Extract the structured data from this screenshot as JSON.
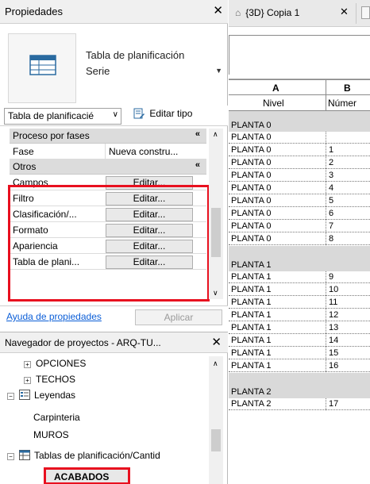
{
  "properties": {
    "title": "Propiedades",
    "type_name_line1": "Tabla de planificación",
    "type_name_line2": "Serie",
    "selector_value": "Tabla de planificacié",
    "edit_type_label": "Editar tipo",
    "groups": [
      {
        "label": "Proceso por fases",
        "rows": [
          {
            "name": "Fase",
            "value": "Nueva constru..."
          }
        ]
      },
      {
        "label": "Otros",
        "rows": [
          {
            "name": "Campos",
            "button": "Editar..."
          },
          {
            "name": "Filtro",
            "button": "Editar..."
          },
          {
            "name": "Clasificación/...",
            "button": "Editar..."
          },
          {
            "name": "Formato",
            "button": "Editar..."
          },
          {
            "name": "Apariencia",
            "button": "Editar..."
          },
          {
            "name": "Tabla de plani...",
            "button": "Editar..."
          }
        ]
      }
    ],
    "help_link": "Ayuda de propiedades",
    "apply_button": "Aplicar"
  },
  "browser": {
    "title": "Navegador de proyectos - ARQ-TU...",
    "items": [
      {
        "label": "OPCIONES",
        "expander": "+"
      },
      {
        "label": "TECHOS",
        "expander": "+"
      },
      {
        "label": "Leyendas",
        "expander": "−"
      },
      {
        "label": "Carpinteria"
      },
      {
        "label": "MUROS"
      },
      {
        "label": "Tablas de planificación/Cantid",
        "expander": "−"
      },
      {
        "label": "ACABADOS"
      }
    ]
  },
  "view": {
    "tab_label": "{3D} Copia 1",
    "columns": [
      {
        "letter": "A",
        "header": "Nivel"
      },
      {
        "letter": "B",
        "header": "Númer"
      }
    ],
    "groups": [
      {
        "label": "PLANTA 0",
        "rows": [
          [
            "PLANTA 0",
            ""
          ],
          [
            "PLANTA 0",
            "1"
          ],
          [
            "PLANTA 0",
            "2"
          ],
          [
            "PLANTA 0",
            "3"
          ],
          [
            "PLANTA 0",
            "4"
          ],
          [
            "PLANTA 0",
            "5"
          ],
          [
            "PLANTA 0",
            "6"
          ],
          [
            "PLANTA 0",
            "7"
          ],
          [
            "PLANTA 0",
            "8"
          ]
        ]
      },
      {
        "label": "PLANTA 1",
        "rows": [
          [
            "PLANTA 1",
            "9"
          ],
          [
            "PLANTA 1",
            "10"
          ],
          [
            "PLANTA 1",
            "11"
          ],
          [
            "PLANTA 1",
            "12"
          ],
          [
            "PLANTA 1",
            "13"
          ],
          [
            "PLANTA 1",
            "14"
          ],
          [
            "PLANTA 1",
            "15"
          ],
          [
            "PLANTA 1",
            "16"
          ]
        ]
      },
      {
        "label": "PLANTA 2",
        "rows": [
          [
            "PLANTA 2",
            "17"
          ]
        ]
      }
    ]
  }
}
